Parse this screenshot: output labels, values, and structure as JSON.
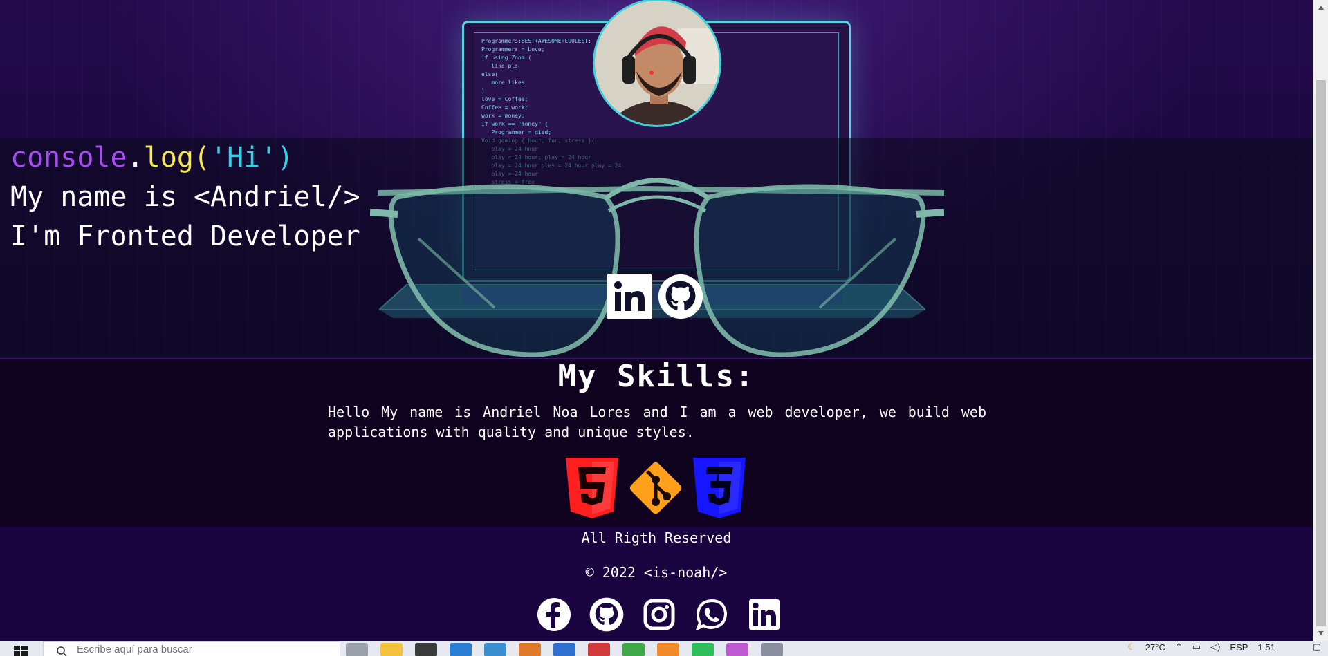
{
  "hero": {
    "intro": {
      "console_word": "console",
      "dot": ".",
      "log_word": "log",
      "paren_open": "(",
      "string_hi": "'Hi'",
      "paren_close": ")",
      "line2": "My name is <Andriel/>",
      "line3": "I'm Fronted Developer"
    },
    "code_lines": [
      "Programmers:BEST+AWESOME+COOLEST:",
      "Programmers = Love;",
      "if using Zoom (",
      "   like pls",
      "else(",
      "   more likes",
      ")",
      "",
      "love = Coffee;",
      "Coffee = work;",
      "work = money;",
      "",
      "if work == \"money\" {",
      "",
      "",
      "   Programmer = died;",
      "",
      "Void gaming ( hour, fun, stress ){",
      "   play = 24 hour",
      "   play = 24 hour; play = 24 hour",
      "   play = 24 hour play = 24 hour play = 24",
      "   play = 24 hour",
      "   stress = free"
    ],
    "social": [
      "linkedin-icon",
      "github-icon"
    ],
    "colors": {
      "purple": "#a64cf0",
      "yellow": "#f4e84a",
      "cyan": "#33d0e8",
      "accent": "#3fd0d8"
    }
  },
  "skills": {
    "title": "My Skills:",
    "text": "Hello My name is Andriel Noa Lores and I am a web developer, we build web applications with quality and unique styles.",
    "icons": [
      "html5-icon",
      "git-icon",
      "css3-icon"
    ]
  },
  "footer": {
    "rights": "All Rigth Reserved",
    "copyright": "© 2022 <is-noah/>",
    "social": [
      "facebook-icon",
      "github-icon",
      "instagram-icon",
      "whatsapp-icon",
      "linkedin-icon"
    ]
  },
  "taskbar": {
    "search_placeholder": "Escribe aquí para buscar",
    "temperature": "27°C",
    "language": "ESP",
    "time": "1:51"
  }
}
